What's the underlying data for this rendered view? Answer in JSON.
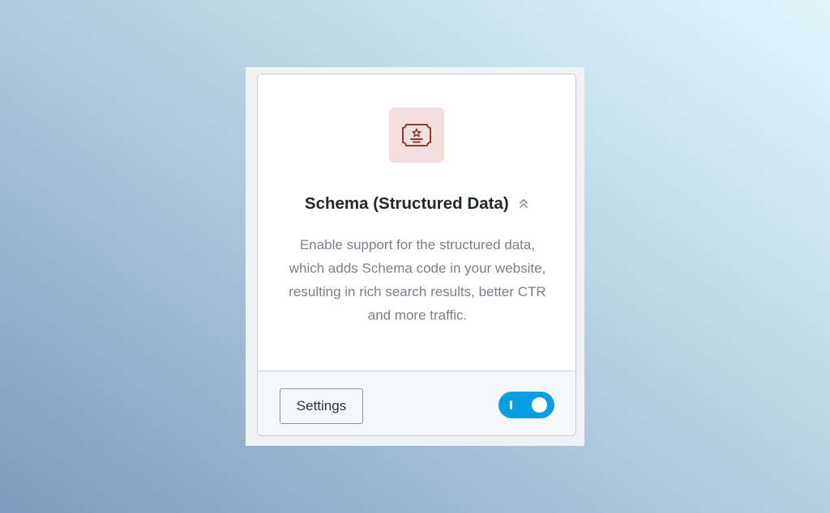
{
  "module": {
    "icon": "certificate-icon",
    "title": "Schema (Structured Data)",
    "title_icon": "double-chevron-up-icon",
    "description": "Enable support for the structured data, which adds Schema code in your website, resulting in rich search results, better CTR and more traffic.",
    "settings_label": "Settings",
    "enabled": true
  },
  "colors": {
    "accent": "#0b9ee0",
    "icon_bg": "#f2e0de",
    "icon_stroke": "#8f3a30",
    "title": "#23282d",
    "description": "#7b8088"
  }
}
